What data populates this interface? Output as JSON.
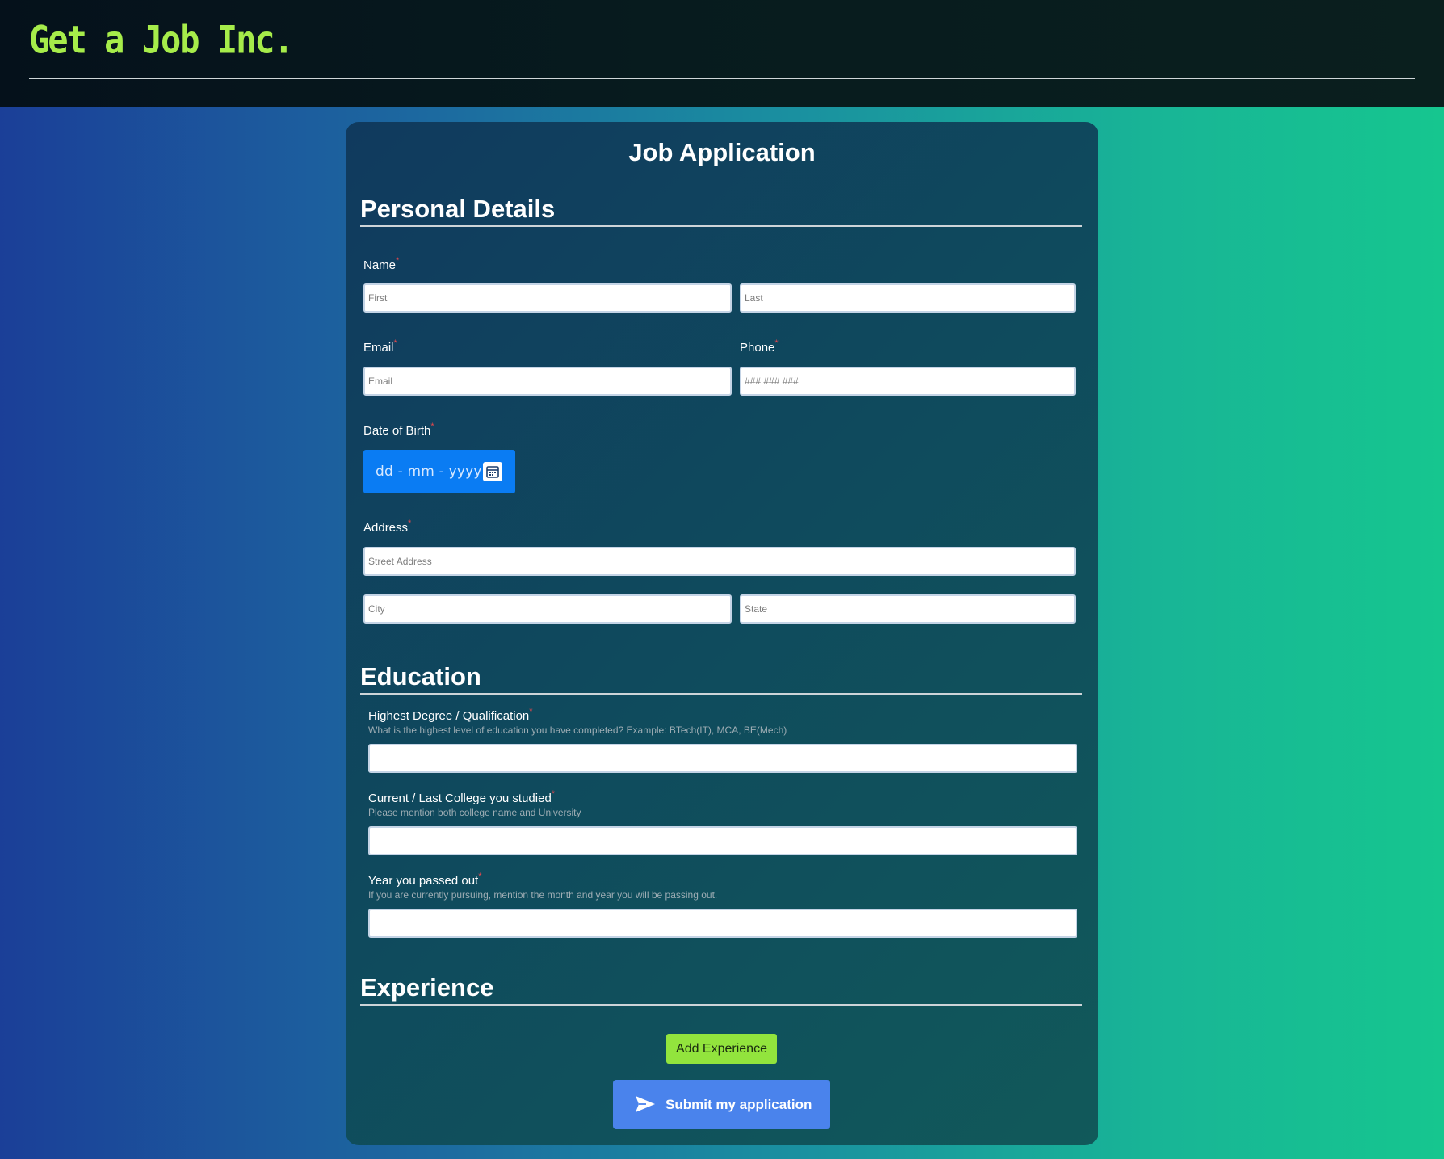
{
  "header": {
    "logo_text": "Get a Job Inc."
  },
  "form": {
    "title": "Job Application",
    "sections": {
      "personal": "Personal Details",
      "education": "Education",
      "experience": "Experience"
    },
    "required_marker": "*",
    "name": {
      "label": "Name",
      "first_placeholder": "First",
      "last_placeholder": "Last"
    },
    "email": {
      "label": "Email",
      "placeholder": "Email"
    },
    "phone": {
      "label": "Phone",
      "placeholder": "### ### ###"
    },
    "dob": {
      "label": "Date of Birth",
      "value_text": "dd - mm - yyyy",
      "icon": "calendar-icon"
    },
    "address": {
      "label": "Address",
      "street_placeholder": "Street Address",
      "city_placeholder": "City",
      "state_placeholder": "State"
    },
    "degree": {
      "label": "Highest Degree / Qualification",
      "hint": "What is the highest level of education you have completed? Example: BTech(IT), MCA, BE(Mech)"
    },
    "college": {
      "label": "Current / Last College you studied",
      "hint": "Please mention both college name and University"
    },
    "year": {
      "label": "Year you passed out",
      "hint": "If you are currently pursuing, mention the month and year you will be passing out."
    },
    "add_experience_label": "Add Experience",
    "submit_label": "Submit my application",
    "submit_icon": "send-icon"
  },
  "colors": {
    "logo": "#a6ec4a",
    "required": "#e5484d",
    "add_button": "#92e43d",
    "submit_button": "#4a83ec",
    "dob_field": "#0a7cf3"
  }
}
